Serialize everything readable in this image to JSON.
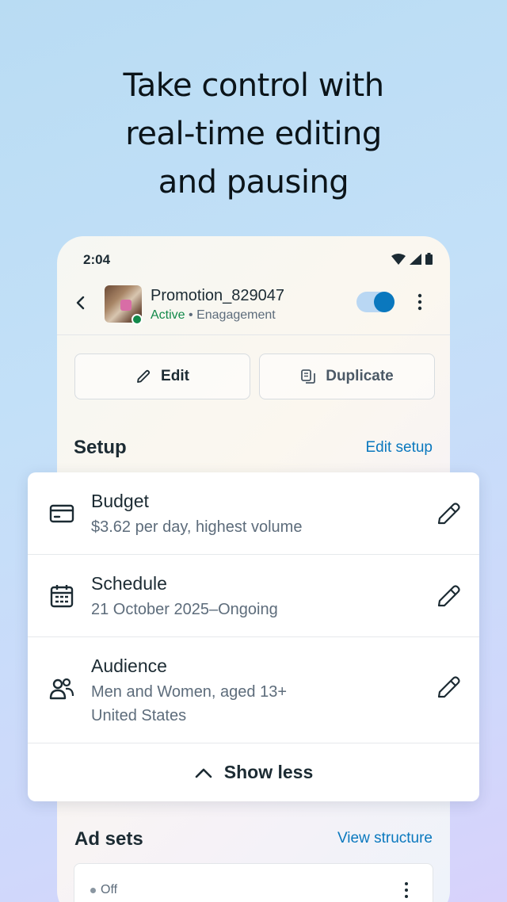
{
  "headline": {
    "line1": "Take control with",
    "line2": "real-time editing",
    "line3": "and pausing"
  },
  "status_bar": {
    "time": "2:04",
    "icons": [
      "wifi-icon",
      "signal-icon",
      "battery-icon"
    ]
  },
  "campaign": {
    "name": "Promotion_829047",
    "status": "Active",
    "separator": " • ",
    "objective": "Enagagement",
    "toggle_on": true
  },
  "actions": {
    "edit_label": "Edit",
    "duplicate_label": "Duplicate"
  },
  "setup": {
    "title": "Setup",
    "link": "Edit setup",
    "rows": [
      {
        "title": "Budget",
        "desc_line1": "$3.62 per day, highest volume",
        "icon": "credit-card-icon"
      },
      {
        "title": "Schedule",
        "desc_line1": "21 October 2025–Ongoing",
        "icon": "calendar-icon"
      },
      {
        "title": "Audience",
        "desc_line1": "Men and Women, aged 13+",
        "desc_line2": "United States",
        "icon": "people-icon"
      }
    ],
    "show_less": "Show less"
  },
  "ad_sets": {
    "title": "Ad sets",
    "link": "View structure",
    "first_status": "Off"
  },
  "colors": {
    "accent": "#0a78be",
    "active_green": "#12894a",
    "text": "#1c2b33",
    "secondary_text": "#5d6c7b"
  }
}
